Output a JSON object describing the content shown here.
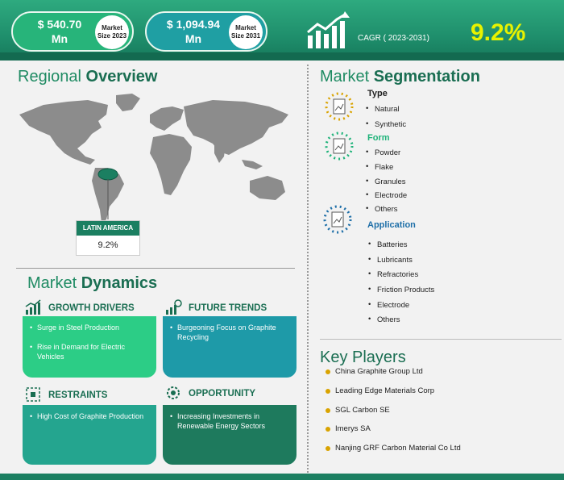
{
  "header": {
    "market_2023_value": "$ 540.70 Mn",
    "market_2023_label": "Market Size 2023",
    "market_2031_value": "$ 1,094.94 Mn",
    "market_2031_label": "Market Size 2031",
    "cagr_label": "CAGR ( 2023-2031)",
    "cagr_value": "9.2%"
  },
  "regional": {
    "title_plain": "Regional ",
    "title_bold": "Overview",
    "region_name": "LATIN AMERICA",
    "region_value": "9.2%"
  },
  "segmentation": {
    "title_plain": "Market ",
    "title_bold": "Segmentation",
    "groups": [
      {
        "name": "Type",
        "items": [
          "Natural",
          "Synthetic"
        ]
      },
      {
        "name": "Form",
        "items": [
          "Powder",
          "Flake",
          "Granules",
          "Electrode",
          "Others"
        ]
      },
      {
        "name": "Application",
        "items": [
          "Batteries",
          "Lubricants",
          "Refractories",
          "Friction Products",
          "Electrode",
          "Others"
        ]
      }
    ]
  },
  "dynamics": {
    "title_plain": "Market ",
    "title_bold": "Dynamics",
    "growth_drivers": {
      "title": "GROWTH DRIVERS",
      "items": [
        "Surge in Steel Production",
        "Rise in Demand for Electric Vehicles"
      ]
    },
    "future_trends": {
      "title": "FUTURE TRENDS",
      "items": [
        "Burgeoning Focus on Graphite Recycling"
      ]
    },
    "restraints": {
      "title": "RESTRAINTS",
      "items": [
        "High Cost of Graphite Production"
      ]
    },
    "opportunity": {
      "title": "OPPORTUNITY",
      "items": [
        "Increasing Investments in Renewable Energy Sectors"
      ]
    }
  },
  "key_players": {
    "title": "Key Players",
    "items": [
      "China Graphite Group Ltd",
      "Leading Edge Materials Corp",
      "SGL Carbon SE",
      "Imerys SA",
      "Nanjing GRF Carbon Material Co Ltd"
    ]
  },
  "colors": {
    "brand_green": "#1b7f61",
    "accent_yellow": "#e8f200",
    "drivers_box": "#2ccd86",
    "trends_box": "#1e9aa8",
    "restraints_box": "#24a58f",
    "opportunity_box": "#1e7a5d"
  }
}
